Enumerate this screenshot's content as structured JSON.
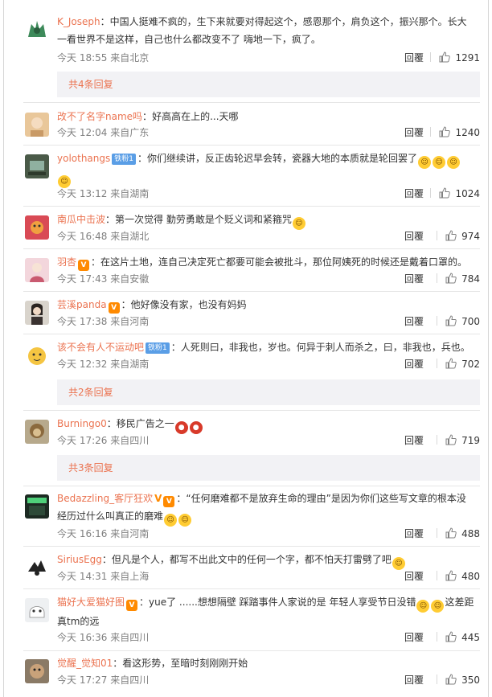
{
  "comments": [
    {
      "username": "K_Joseph",
      "text": "中国人挺难不疯的，生下来就要对得起这个，感恩那个，肩负这个，振兴那个。长大一看世界不是这样，自己也什么都改变不了 嗨地一下，疯了。",
      "time": "今天 18:55 来自北京",
      "reply": "回覆",
      "likes": "1291",
      "more_replies": "共4条回复"
    },
    {
      "username": "改不了名字name吗",
      "text": "好高高在上的...天哪",
      "time": "今天 12:04 来自广东",
      "reply": "回覆",
      "likes": "1240"
    },
    {
      "username": "yolothangs",
      "badge": "铁粉1",
      "text": "你们继续讲，反正齿轮迟早会转，瓷器大地的本质就是轮回罢了",
      "time": "今天 13:12 来自湖南",
      "reply": "回覆",
      "likes": "1024"
    },
    {
      "username": "南瓜中击波",
      "text": "第一次觉得 勤劳勇敢是个贬义词和紧箍咒",
      "time": "今天 16:48 来自湖北",
      "reply": "回覆",
      "likes": "974"
    },
    {
      "username": "羽杏",
      "text": "在这片土地，连自己决定死亡都要可能会被批斗，那位阿姨死的时候还是戴着口罩的。",
      "time": "今天 17:43 来自安徽",
      "reply": "回覆",
      "likes": "784"
    },
    {
      "username": "芸溪panda",
      "text": "他好像没有家，也没有妈妈",
      "time": "今天 17:38 来自河南",
      "reply": "回覆",
      "likes": "700"
    },
    {
      "username": "该不会有人不运动吧",
      "badge": "铁粉1",
      "text": "人死则曰，非我也，岁也。何异于刺人而杀之，曰，非我也，兵也。",
      "time": "今天 12:32 来自湖南",
      "reply": "回覆",
      "likes": "702",
      "more_replies": "共2条回复"
    },
    {
      "username": "Burningo0",
      "text": "移民广告之一",
      "time": "今天 17:26 来自四川",
      "reply": "回覆",
      "likes": "719",
      "more_replies": "共3条回复"
    },
    {
      "username": "Bedazzling_客厅狂欢",
      "text": "“任何磨难都不是放弃生命的理由”是因为你们这些写文章的根本没经历过什么叫真正的磨难",
      "time": "今天 16:16 来自河南",
      "reply": "回覆",
      "likes": "488"
    },
    {
      "username": "SiriusEgg",
      "text": "但凡是个人，都写不出此文中的任何一个字，都不怕天打雷劈了吧",
      "time": "今天 14:31 来自上海",
      "reply": "回覆",
      "likes": "480"
    },
    {
      "username": "猫好大爱猫好图",
      "text": "yue了 ......想想隔壁 踩踏事件人家说的是 年轻人享受节日没错",
      "text2": "这差距真tm的远",
      "time": "今天 16:36 来自四川",
      "reply": "回覆",
      "likes": "445"
    },
    {
      "username": "觉醒_觉知01",
      "text": "看这形势，至暗时刻刚刚开始",
      "time": "今天 17:27 来自四川",
      "reply": "回覆",
      "likes": "350"
    }
  ],
  "colors": {
    "username": "#eb7350",
    "meta": "#808080",
    "more_bg": "#f2f2f5",
    "badge": "#5a9ee6",
    "vip": "#ff8a00"
  },
  "icons": {
    "like": "thumb-up-icon",
    "badge": "fan-badge-icon",
    "vip": "vip-crown-icon",
    "emoji": "emoji-icon"
  }
}
